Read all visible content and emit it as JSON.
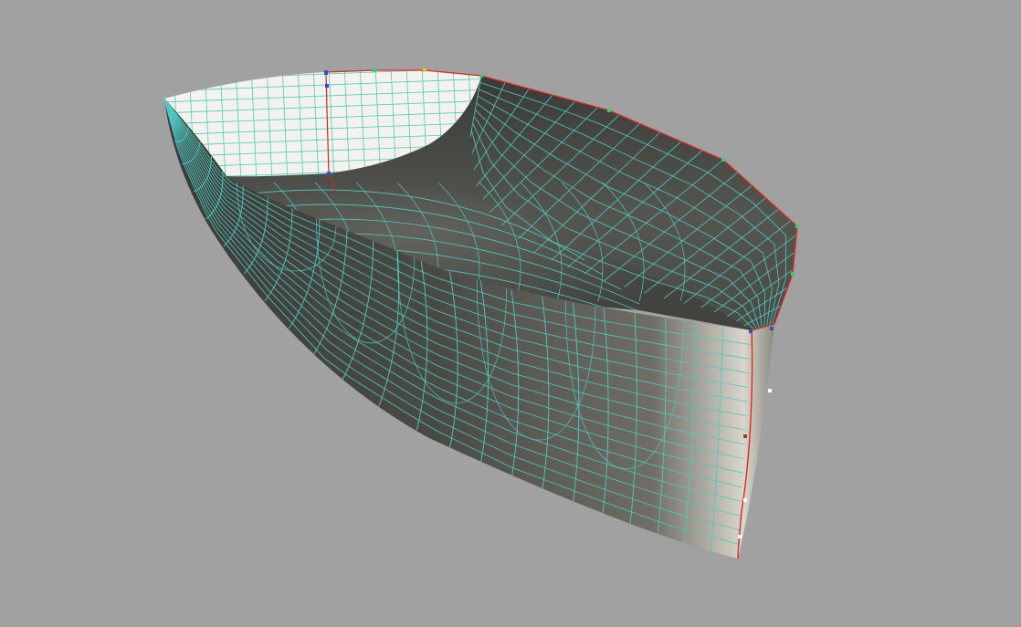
{
  "viewport": {
    "background": "#a1a1a1",
    "model": "boat-hull",
    "render_mode": "shaded-with-wireframe"
  },
  "colors": {
    "hull_dark": "#3a3b37",
    "hull_mid": "#6b6a62",
    "hull_light": "#d9d6cc",
    "transom": "#f4f2ec",
    "wireframe": "#4fc9c4",
    "sheer_line": "#e0281e",
    "control_blue": "#2a4fd1",
    "control_green": "#32d16b",
    "control_yellow": "#e8d21a",
    "control_white": "#ffffff",
    "control_brown": "#7a4a20"
  },
  "control_points": {
    "sheer": [
      "control_blue",
      "control_green",
      "control_yellow",
      "control_green",
      "control_green",
      "control_green",
      "control_green",
      "control_green",
      "control_blue"
    ],
    "transom": [
      "control_blue",
      "control_blue",
      "control_blue"
    ],
    "stem": [
      "control_white",
      "control_brown",
      "control_white",
      "control_white"
    ]
  }
}
